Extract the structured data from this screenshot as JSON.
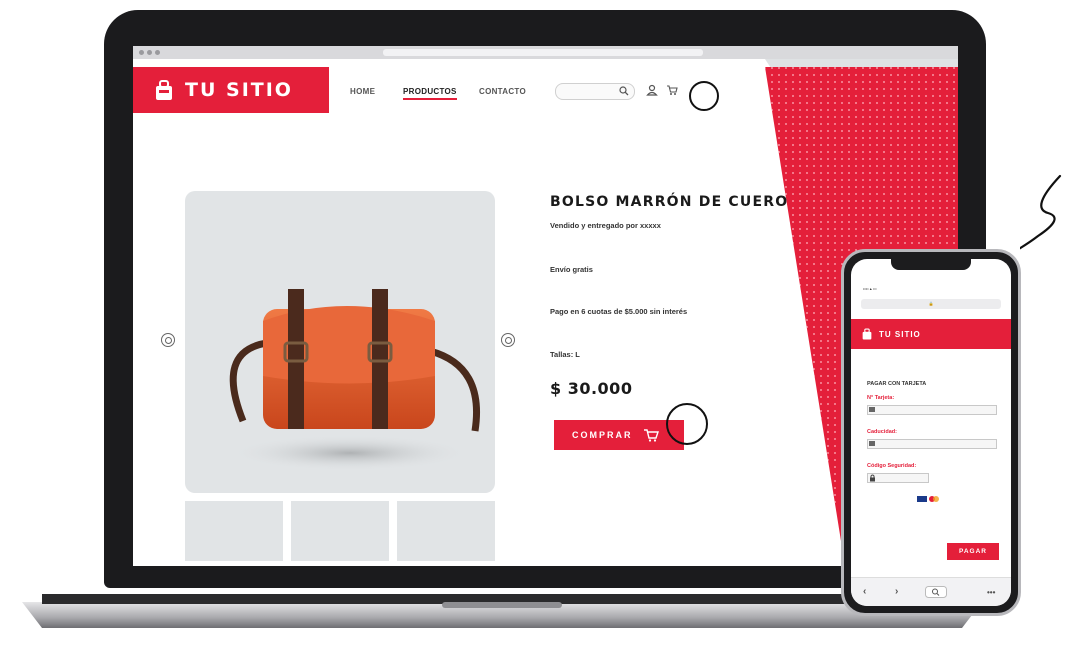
{
  "site": {
    "brand": "TU SITIO",
    "nav": [
      {
        "label": "HOME"
      },
      {
        "label": "PRODUCTOS"
      },
      {
        "label": "CONTACTO"
      }
    ]
  },
  "product": {
    "title": "BOLSO MARRÓN DE CUERO",
    "seller": "Vendido y entregado por xxxxx",
    "shipping": "Envío gratis",
    "installments": "Pago en 6 cuotas de $5.000 sin interés",
    "sizes": "Tallas: L",
    "price": "$ 30.000",
    "buy_label": "COMPRAR"
  },
  "mobile": {
    "brand": "TU SITIO",
    "card_title": "PAGAR CON TARJETA",
    "field_card_number": "N° Tarjeta:",
    "field_expiry": "Caducidad:",
    "field_security": "Código Seguridad:",
    "pay_label": "PAGAR"
  },
  "colors": {
    "accent": "#e41f3a",
    "device_frame": "#1b1b1d"
  },
  "icons": [
    "bag-logo-icon",
    "search-icon",
    "user-icon",
    "cart-icon",
    "prev-arrow-icon",
    "next-arrow-icon",
    "lock-icon",
    "card-brands-icon"
  ]
}
